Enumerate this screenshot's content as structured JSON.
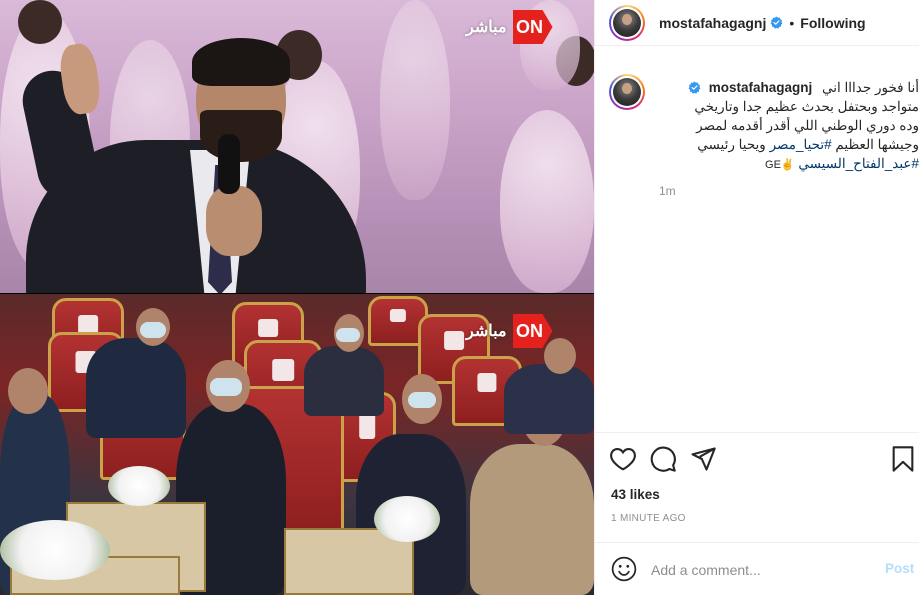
{
  "media": {
    "channel_logo": {
      "text": "مباشر",
      "badge": "ON",
      "color": "#e4211c"
    }
  },
  "header": {
    "username": "mostafahagagnj",
    "separator": "•",
    "follow_status": "Following",
    "verified_icon": "verified-badge-icon",
    "verified_color": "#3897f0"
  },
  "caption": {
    "username": "mostafahagagnj",
    "line1": "أنا فخور جدااا اني",
    "line2": "متواجد وبحتفل بحدث عظيم جدا وتاريخي",
    "line3": "وده دوري الوطني اللي أقدر أقدمه لمصر",
    "line4_text": "وجيشها العظيم",
    "hashtag1": "#تحيا_مصر",
    "line4_tail": "ويحيا رئيسي",
    "hashtag2": "#عبد_الفتاح_السيسي",
    "suffix": "GE✌️",
    "time": "1m"
  },
  "actions": {
    "icons": [
      "heart-icon",
      "comment-icon",
      "share-icon",
      "bookmark-icon"
    ]
  },
  "likes": "43 likes",
  "timestamp": "1 MINUTE AGO",
  "comment": {
    "placeholder": "Add a comment...",
    "post_label": "Post",
    "emoji_icon": "emoji-icon"
  },
  "colors": {
    "link": "#00376b",
    "muted": "#8e8e8e",
    "post_disabled": "#b2dffc"
  }
}
